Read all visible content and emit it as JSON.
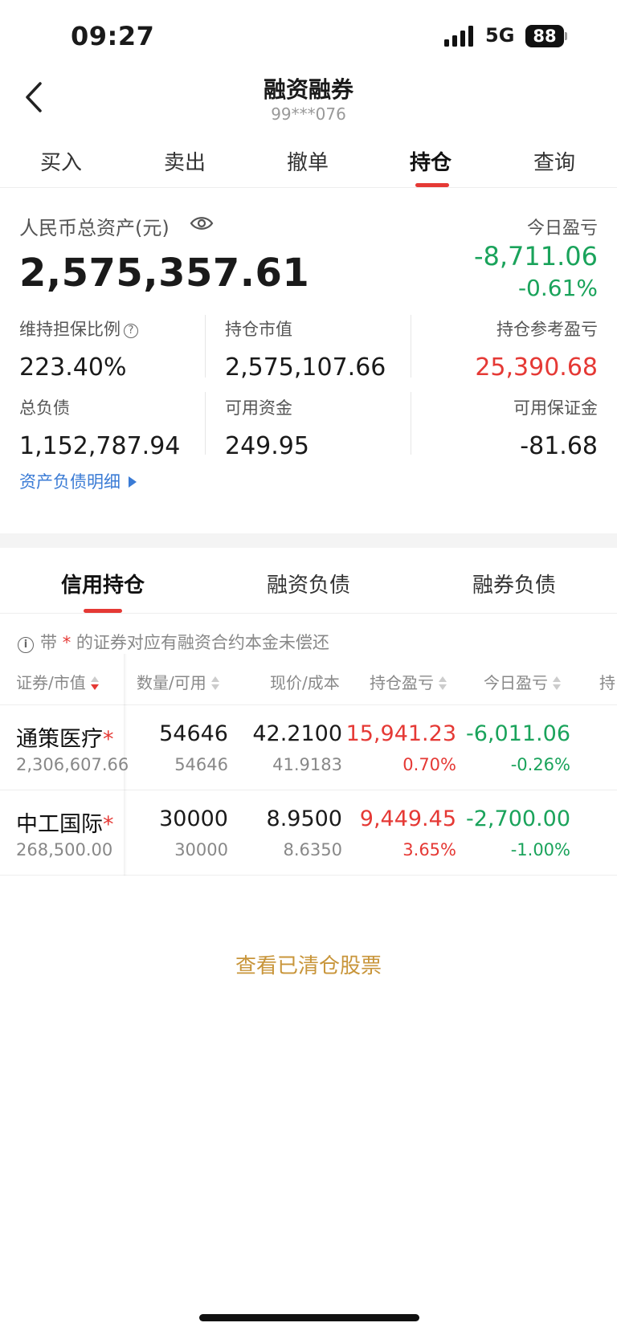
{
  "status": {
    "time": "09:27",
    "network": "5G",
    "battery": "88"
  },
  "nav": {
    "title": "融资融券",
    "account": "99***076"
  },
  "tabs": [
    "买入",
    "卖出",
    "撤单",
    "持仓",
    "查询"
  ],
  "asset": {
    "label": "人民币总资产(元)",
    "total": "2,575,357.61",
    "today_label": "今日盈亏",
    "today_value": "-8,711.06",
    "today_pct": "-0.61%"
  },
  "metrics": {
    "ratio_label": "维持担保比例",
    "ratio_value": "223.40%",
    "mv_label": "持仓市值",
    "mv_value": "2,575,107.66",
    "ref_pl_label": "持仓参考盈亏",
    "ref_pl_value": "25,390.68",
    "debt_label": "总负债",
    "debt_value": "1,152,787.94",
    "cash_label": "可用资金",
    "cash_value": "249.95",
    "margin_label": "可用保证金",
    "margin_value": "-81.68"
  },
  "detail_link": "资产负债明细",
  "sub_tabs": [
    "信用持仓",
    "融资负债",
    "融券负债"
  ],
  "note": {
    "prefix": "带",
    "star": "*",
    "suffix": "的证券对应有融资合约本金未偿还"
  },
  "table": {
    "headers": [
      "证券/市值",
      "数量/可用",
      "现价/成本",
      "持仓盈亏",
      "今日盈亏",
      "持"
    ],
    "rows": [
      {
        "name": "通策医疗",
        "star": "*",
        "mv": "2,306,607.66",
        "qty": "54646",
        "avail": "54646",
        "price": "42.2100",
        "cost": "41.9183",
        "pl": "15,941.23",
        "pl_pct": "0.70%",
        "today": "-6,011.06",
        "today_pct": "-0.26%"
      },
      {
        "name": "中工国际",
        "star": "*",
        "mv": "268,500.00",
        "qty": "30000",
        "avail": "30000",
        "price": "8.9500",
        "cost": "8.6350",
        "pl": "9,449.45",
        "pl_pct": "3.65%",
        "today": "-2,700.00",
        "today_pct": "-1.00%"
      }
    ]
  },
  "cleared_link": "查看已清仓股票",
  "colors": {
    "up": "#e53935",
    "down": "#1aa35b",
    "link": "#3a7bd5",
    "accent": "#c8953a"
  }
}
